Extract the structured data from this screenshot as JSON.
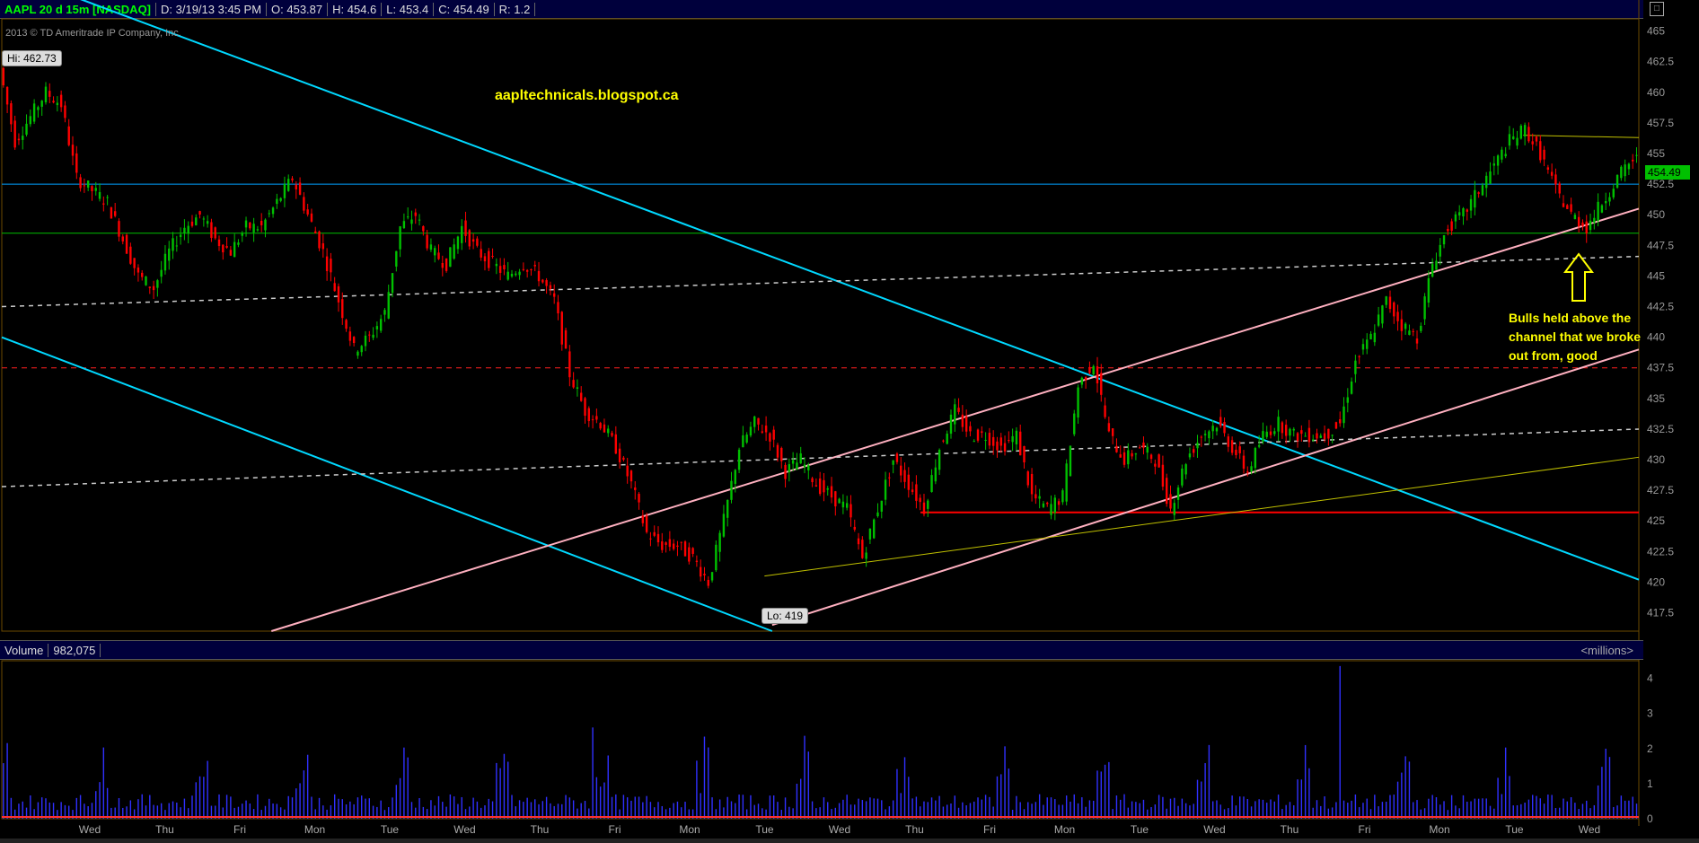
{
  "header": {
    "symbol": "AAPL 20 d 15m [NASDAQ]",
    "date": "D: 3/19/13 3:45 PM",
    "open": "O: 453.87",
    "high": "H: 454.6",
    "low": "L: 453.4",
    "close": "C: 454.49",
    "range": "R: 1.2"
  },
  "copyright": "2013 © TD Ameritrade IP Company, Inc.",
  "watermark": "aapltechnicals.blogspot.ca",
  "annotation": "Bulls held above the channel that we broke out from, good",
  "hi_label": "Hi: 462.73",
  "lo_label": "Lo: 419",
  "last_price": "454.49",
  "volume_header": {
    "label": "Volume",
    "value": "982,075",
    "units": "<millions>"
  },
  "colors": {
    "up": "#00c000",
    "down": "#ff0000",
    "cyan": "#00c8ff",
    "pink": "#ffb0c0",
    "volume": "#3030ff"
  },
  "chart_data": [
    {
      "type": "line",
      "title": "AAPL 20 d 15m [NASDAQ]",
      "ylim": [
        416,
        466
      ],
      "y_ticks": [
        "465",
        "462.5",
        "460",
        "457.5",
        "455",
        "452.5",
        "450",
        "447.5",
        "445",
        "442.5",
        "440",
        "437.5",
        "435",
        "432.5",
        "430",
        "427.5",
        "425",
        "422.5",
        "420",
        "417.5"
      ],
      "x_ticks": [
        "Wed",
        "Thu",
        "Fri",
        "Mon",
        "Tue",
        "Wed",
        "Thu",
        "Fri",
        "Mon",
        "Tue",
        "Wed",
        "Thu",
        "Fri",
        "Mon",
        "Tue",
        "Wed",
        "Thu",
        "Fri",
        "Mon",
        "Tue",
        "Wed"
      ],
      "price_path": [
        [
          0,
          462
        ],
        [
          4,
          456
        ],
        [
          8,
          458
        ],
        [
          12,
          460
        ],
        [
          16,
          459
        ],
        [
          20,
          453
        ],
        [
          24,
          452
        ],
        [
          28,
          451
        ],
        [
          32,
          448
        ],
        [
          36,
          445
        ],
        [
          40,
          444
        ],
        [
          44,
          447
        ],
        [
          48,
          449
        ],
        [
          52,
          450
        ],
        [
          56,
          448
        ],
        [
          60,
          447
        ],
        [
          64,
          449
        ],
        [
          68,
          449
        ],
        [
          72,
          451
        ],
        [
          76,
          453
        ],
        [
          80,
          450
        ],
        [
          84,
          447
        ],
        [
          88,
          443
        ],
        [
          92,
          439
        ],
        [
          96,
          440
        ],
        [
          100,
          442
        ],
        [
          104,
          449
        ],
        [
          108,
          450
        ],
        [
          112,
          447
        ],
        [
          116,
          446
        ],
        [
          120,
          449
        ],
        [
          124,
          447
        ],
        [
          128,
          446
        ],
        [
          132,
          445
        ],
        [
          136,
          446
        ],
        [
          140,
          445
        ],
        [
          144,
          443
        ],
        [
          148,
          437
        ],
        [
          152,
          434
        ],
        [
          156,
          433
        ],
        [
          160,
          431
        ],
        [
          164,
          428
        ],
        [
          168,
          424
        ],
        [
          172,
          423
        ],
        [
          176,
          423
        ],
        [
          180,
          422
        ],
        [
          184,
          420
        ],
        [
          188,
          425
        ],
        [
          192,
          431
        ],
        [
          196,
          433
        ],
        [
          200,
          432
        ],
        [
          204,
          429
        ],
        [
          208,
          430
        ],
        [
          212,
          428
        ],
        [
          216,
          427
        ],
        [
          220,
          426
        ],
        [
          224,
          422
        ],
        [
          228,
          426
        ],
        [
          232,
          430
        ],
        [
          236,
          428
        ],
        [
          240,
          426
        ],
        [
          244,
          431
        ],
        [
          248,
          434
        ],
        [
          252,
          432
        ],
        [
          256,
          432
        ],
        [
          260,
          431
        ],
        [
          264,
          432
        ],
        [
          268,
          427
        ],
        [
          272,
          426
        ],
        [
          276,
          427
        ],
        [
          280,
          436
        ],
        [
          284,
          438
        ],
        [
          288,
          432
        ],
        [
          292,
          430
        ],
        [
          296,
          431
        ],
        [
          300,
          430
        ],
        [
          304,
          426
        ],
        [
          308,
          430
        ],
        [
          312,
          432
        ],
        [
          316,
          433
        ],
        [
          320,
          431
        ],
        [
          324,
          429
        ],
        [
          328,
          432
        ],
        [
          332,
          433
        ],
        [
          336,
          432
        ],
        [
          340,
          432
        ],
        [
          344,
          432
        ],
        [
          348,
          433
        ],
        [
          352,
          438
        ],
        [
          356,
          440
        ],
        [
          360,
          443
        ],
        [
          364,
          441
        ],
        [
          368,
          440
        ],
        [
          372,
          446
        ],
        [
          376,
          449
        ],
        [
          380,
          450
        ],
        [
          384,
          452
        ],
        [
          388,
          454
        ],
        [
          392,
          456
        ],
        [
          396,
          457
        ],
        [
          400,
          455
        ],
        [
          404,
          452
        ],
        [
          408,
          450
        ],
        [
          412,
          449
        ],
        [
          416,
          451
        ],
        [
          420,
          453
        ],
        [
          424,
          454.49
        ]
      ],
      "hi": 462.73,
      "lo": 419,
      "last": 454.49
    },
    {
      "type": "bar",
      "title": "Volume",
      "ylabel": "<millions>",
      "y_ticks": [
        "4",
        "3",
        "2",
        "1",
        "0"
      ],
      "ylim": [
        0,
        4.5
      ]
    }
  ]
}
